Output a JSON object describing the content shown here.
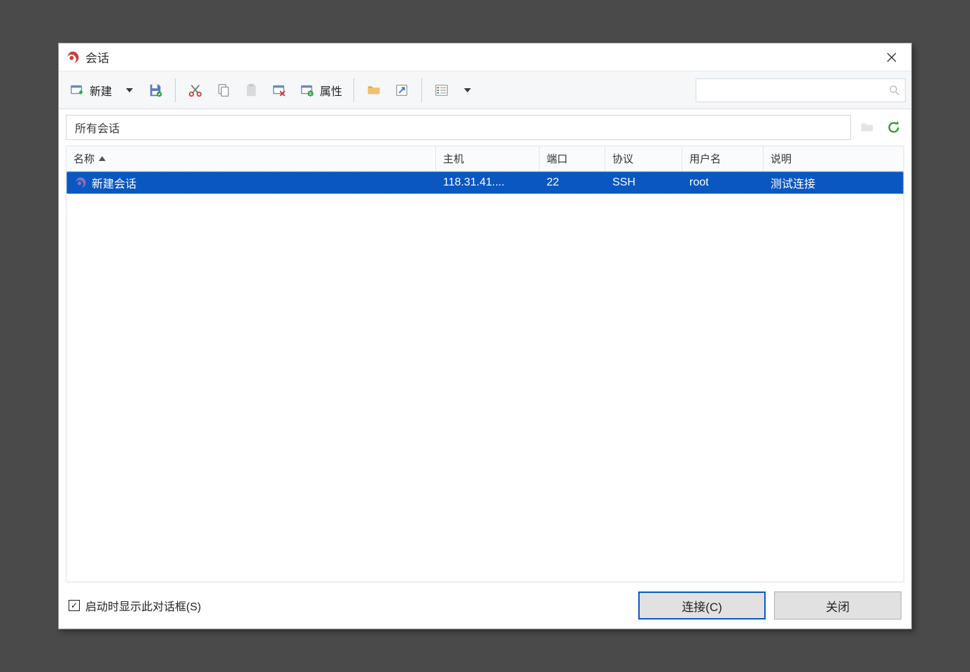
{
  "window": {
    "title": "会话"
  },
  "toolbar": {
    "new_label": "新建",
    "properties_label": "属性"
  },
  "pathbar": {
    "value": "所有会话"
  },
  "table": {
    "headers": {
      "name": "名称",
      "host": "主机",
      "port": "端口",
      "protocol": "协议",
      "username": "用户名",
      "description": "说明"
    },
    "rows": [
      {
        "name": "新建会话",
        "host": "118.31.41....",
        "port": "22",
        "protocol": "SSH",
        "username": "root",
        "description": "测试连接",
        "selected": true
      }
    ]
  },
  "footer": {
    "checkbox_label": "启动时显示此对话框(S)",
    "checkbox_checked": true,
    "connect_label": "连接(C)",
    "close_label": "关闭"
  },
  "search": {
    "placeholder": ""
  }
}
